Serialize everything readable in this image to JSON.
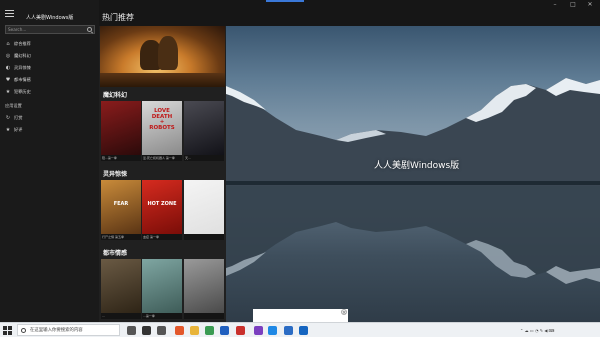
{
  "window": {
    "controls": [
      "–",
      "□",
      "✕"
    ]
  },
  "sidebar": {
    "app_title": "人人美剧Windows版",
    "search_placeholder": "Search...",
    "items": [
      {
        "label": "综合推荐",
        "icon": "home-icon"
      },
      {
        "label": "魔幻科幻",
        "icon": "globe-icon"
      },
      {
        "label": "灵异惊悚",
        "icon": "ghost-icon"
      },
      {
        "label": "都市情感",
        "icon": "heart-icon"
      },
      {
        "label": "犯罪历史",
        "icon": "star-icon"
      }
    ],
    "section_label": "应用设置",
    "settings": [
      {
        "label": "打赏",
        "icon": "refresh-icon"
      },
      {
        "label": "好评",
        "icon": "star-icon"
      }
    ]
  },
  "page": {
    "title": "热门推荐"
  },
  "banner": {
    "dots": 6,
    "active_dot": 1
  },
  "categories": [
    {
      "title": "魔幻科幻",
      "posters": [
        {
          "title": "",
          "art_text": "",
          "caption": "陪...第一季",
          "colors": [
            "#8a1c1c",
            "#2b0a0a"
          ]
        },
        {
          "title": "LOVE DEATH + ROBOTS",
          "art_text": "LOVE\nDEATH\n+\nROBOTS",
          "caption": "爱,死亡和机器人 第一季",
          "colors": [
            "#d8d8d8",
            "#8a8a8a"
          ]
        },
        {
          "title": "",
          "art_text": "",
          "caption": "天...",
          "colors": [
            "#4a4a52",
            "#121218"
          ]
        }
      ]
    },
    {
      "title": "灵异惊悚",
      "posters": [
        {
          "title": "FEAR THE WALKING DEAD",
          "art_text": "FEAR",
          "caption": "行尸之惧 第五季",
          "colors": [
            "#c98b3a",
            "#5a3414"
          ]
        },
        {
          "title": "HOT ZONE",
          "art_text": "HOT ZONE",
          "caption": "血疫 第一季",
          "colors": [
            "#d62b1f",
            "#7a0d08"
          ]
        },
        {
          "title": "",
          "art_text": "",
          "caption": "",
          "colors": [
            "#f4f4f4",
            "#e0e0e0"
          ]
        }
      ]
    },
    {
      "title": "都市情感",
      "posters": [
        {
          "title": "",
          "art_text": "",
          "caption": "...",
          "colors": [
            "#6a5a44",
            "#2e2416"
          ]
        },
        {
          "title": "",
          "art_text": "",
          "caption": "...第一季",
          "colors": [
            "#7fa6a2",
            "#3e5c58"
          ]
        },
        {
          "title": "",
          "art_text": "",
          "caption": "",
          "colors": [
            "#9a9a9a",
            "#4a4a4a"
          ]
        }
      ]
    }
  ],
  "preview": {
    "title": "人人美剧Windows版"
  },
  "taskbar": {
    "search_text": "在这里输入你要搜索的内容",
    "apps": [
      {
        "name": "task-view-icon",
        "color": "#555"
      },
      {
        "name": "store-icon",
        "color": "#333"
      },
      {
        "name": "mail-icon",
        "color": "#555"
      },
      {
        "name": "firefox-icon",
        "color": "#e3582b"
      },
      {
        "name": "folder-icon",
        "color": "#e8b43a"
      },
      {
        "name": "chrome-icon",
        "color": "#3a9b52"
      },
      {
        "name": "app-icon",
        "color": "#1f5fbf"
      },
      {
        "name": "app-icon",
        "color": "#c9302c"
      },
      {
        "name": "visual-studio-icon",
        "color": "#7b3fbf"
      },
      {
        "name": "vscode-icon",
        "color": "#1e88e5"
      },
      {
        "name": "app-icon",
        "color": "#2b6cc4"
      },
      {
        "name": "app-icon",
        "color": "#1565c0"
      }
    ]
  }
}
